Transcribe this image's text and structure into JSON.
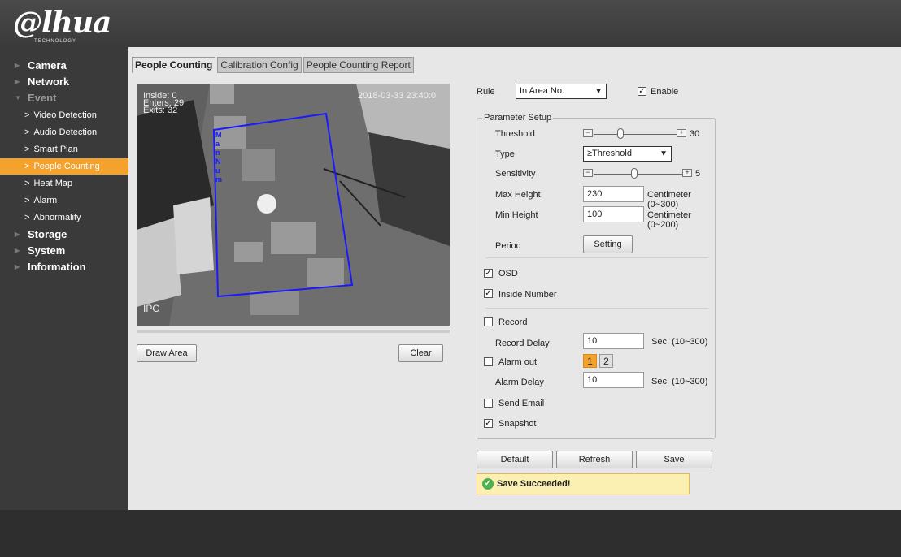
{
  "brand": {
    "logo": "@lhua",
    "sub": "TECHNOLOGY"
  },
  "nav": {
    "camera": "Camera",
    "network": "Network",
    "event": "Event",
    "sub": [
      "Video Detection",
      "Audio Detection",
      "Smart Plan",
      "People Counting",
      "Heat Map",
      "Alarm",
      "Abnormality"
    ],
    "storage": "Storage",
    "system": "System",
    "information": "Information"
  },
  "tabs": [
    "People Counting",
    "Calibration Config",
    "People Counting Report"
  ],
  "video": {
    "osd_inside": "Inside: 0",
    "osd_enters": "Enters: 29",
    "osd_exits": "Exits: 32",
    "osd_time": "2018-03-33 23:40:0",
    "osd_channel": "IPC",
    "area_label": "M a n N u m"
  },
  "buttons": {
    "draw_area": "Draw Area",
    "clear": "Clear",
    "setting": "Setting",
    "default": "Default",
    "refresh": "Refresh",
    "save": "Save"
  },
  "rule": {
    "label": "Rule",
    "value": "In Area No.",
    "enable_label": "Enable",
    "enabled": true
  },
  "params": {
    "legend": "Parameter Setup",
    "threshold_label": "Threshold",
    "threshold_value": "30",
    "type_label": "Type",
    "type_value": "≥Threshold",
    "sensitivity_label": "Sensitivity",
    "sensitivity_value": "5",
    "max_height_label": "Max Height",
    "max_height_value": "230",
    "max_height_unit": "Centimeter (0~300)",
    "min_height_label": "Min Height",
    "min_height_value": "100",
    "min_height_unit": "Centimeter (0~200)",
    "period_label": "Period",
    "osd_label": "OSD",
    "inside_number_label": "Inside Number",
    "record_label": "Record",
    "record_delay_label": "Record Delay",
    "record_delay_value": "10",
    "record_delay_unit": "Sec. (10~300)",
    "alarm_out_label": "Alarm out",
    "alarm_out_1": "1",
    "alarm_out_2": "2",
    "alarm_delay_label": "Alarm Delay",
    "alarm_delay_value": "10",
    "alarm_delay_unit": "Sec. (10~300)",
    "send_email_label": "Send Email",
    "snapshot_label": "Snapshot"
  },
  "status": {
    "message": "Save Succeeded!"
  },
  "colors": {
    "accent": "#f5a22d",
    "area_line": "#1a1aff"
  }
}
